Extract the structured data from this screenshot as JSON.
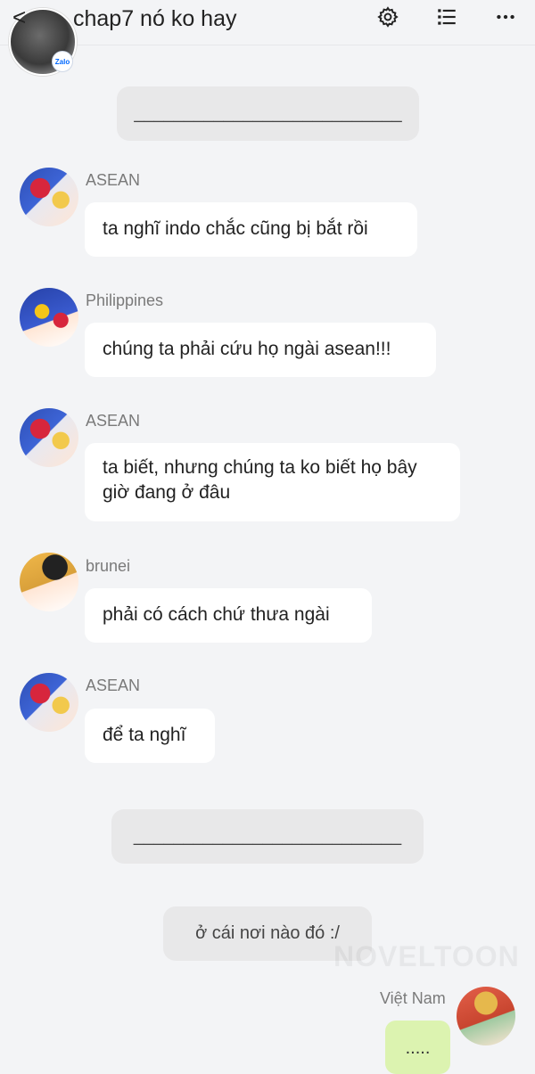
{
  "header": {
    "title": "chap7 nó ko hay",
    "back_glyph": "<",
    "badge": "Zalo",
    "icons": [
      "back-icon",
      "gear-icon",
      "list-icon",
      "more-icon"
    ]
  },
  "messages": {
    "separator_top": "___________________________",
    "separator_bottom": "___________________________",
    "m1": {
      "sender": "ASEAN",
      "text": "ta nghĩ indo chắc cũng bị bắt rồi"
    },
    "m2": {
      "sender": "Philippines",
      "text": "chúng ta phải cứu họ ngài asean!!!"
    },
    "m3": {
      "sender": "ASEAN",
      "text": "ta biết, nhưng chúng ta ko biết họ bây giờ đang ở đâu"
    },
    "m4": {
      "sender": "brunei",
      "text": "phải có cách chứ thưa ngài"
    },
    "m5": {
      "sender": "ASEAN",
      "text": "để ta nghĩ"
    },
    "narration": "ở cái nơi nào đó :/",
    "outgoing": {
      "sender": "Việt Nam",
      "text": "....."
    }
  },
  "watermark": "NOVELTOON",
  "colors": {
    "background": "#f3f4f6",
    "bubble": "#ffffff",
    "system": "#e8e8e9",
    "outgoing": "#dcf3b0"
  }
}
